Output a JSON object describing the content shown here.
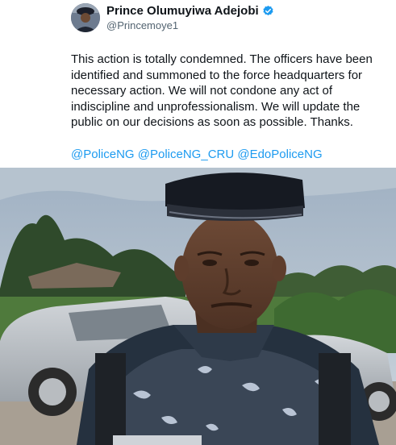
{
  "tweet": {
    "display_name": "Prince Olumuyiwa Adejobi",
    "handle": "@Princemoye1",
    "verified_color": "#1d9bf0",
    "body": "This action is totally condemned.  The officers have been identified and summoned to the force headquarters for necessary action. We will not condone any act of indiscipline and unprofessionalism. We will update the public on our decisions as soon  as possible. Thanks.",
    "mentions": [
      "@PoliceNG",
      "@PoliceNG_CRU",
      "@EdoPoliceNG"
    ],
    "link_color": "#1d9bf0"
  },
  "media": {
    "description_icon": "photo-of-police-officer-icon"
  }
}
